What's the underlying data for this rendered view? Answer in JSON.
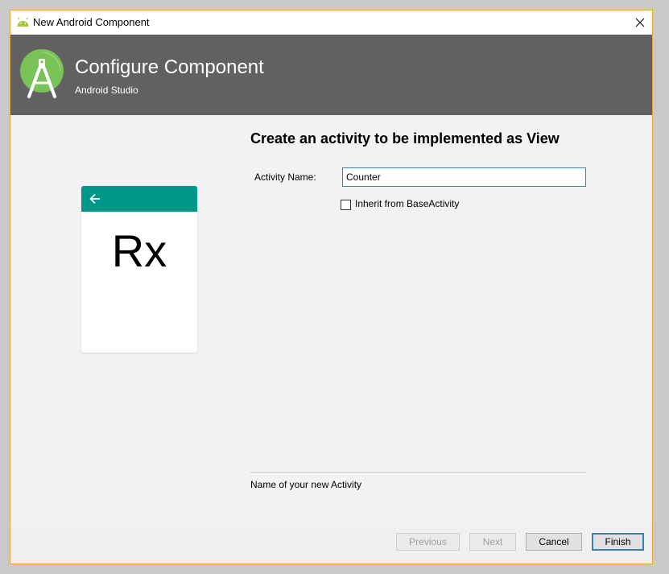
{
  "window": {
    "title": "New Android Component",
    "accent_border": "#e8a33d"
  },
  "header": {
    "title": "Configure Component",
    "subtitle": "Android Studio",
    "background": "#616161",
    "logo_icon": "android-studio-logo-icon"
  },
  "preview": {
    "label": "Rx",
    "bar_color": "#009688",
    "back_icon": "arrow-left-icon"
  },
  "form": {
    "heading": "Create an activity to be implemented as View",
    "activity_name_label": "Activity Name:",
    "activity_name_value": "Counter",
    "inherit_checkbox_label": "Inherit from BaseActivity",
    "inherit_checked": false,
    "help_text": "Name of your new Activity"
  },
  "footer": {
    "previous_label": "Previous",
    "next_label": "Next",
    "cancel_label": "Cancel",
    "finish_label": "Finish"
  }
}
